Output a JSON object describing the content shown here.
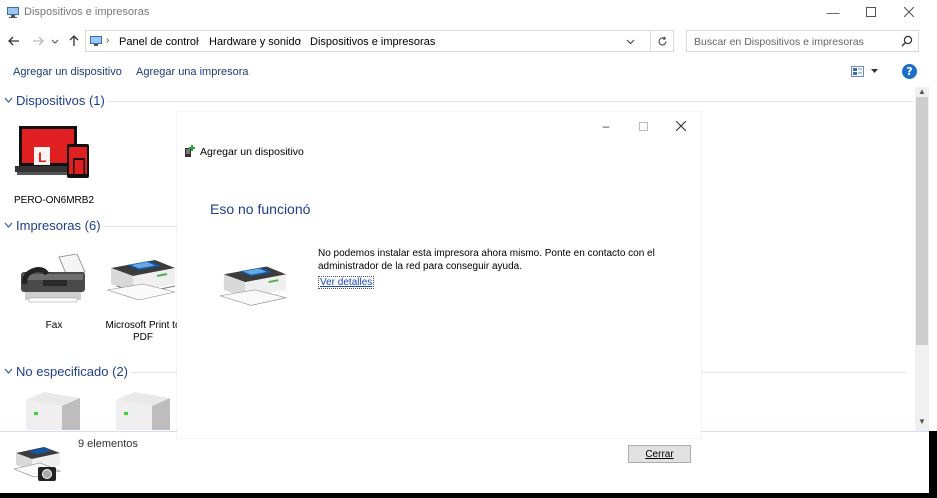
{
  "window": {
    "title": "Dispositivos e impresoras"
  },
  "address": {
    "crumbs": [
      "Panel de control",
      "Hardware y sonido",
      "Dispositivos e impresoras"
    ],
    "search_placeholder": "Buscar en Dispositivos e impresoras"
  },
  "commands": {
    "add_device": "Agregar un dispositivo",
    "add_printer": "Agregar una impresora"
  },
  "groups": {
    "devices": {
      "header": "Dispositivos (1)",
      "items": [
        "PERO-ON6MRB2"
      ]
    },
    "printers": {
      "header": "Impresoras (6)",
      "items": [
        "Fax",
        "Microsoft Print to PDF"
      ]
    },
    "unspecified": {
      "header": "No especificado (2)"
    }
  },
  "details": {
    "count": "9 elementos"
  },
  "dialog": {
    "header": "Agregar un dispositivo",
    "title": "Eso no funcionó",
    "message": "No podemos instalar esta impresora ahora mismo. Ponte en contacto con el administrador de la red para conseguir ayuda.",
    "link": "Ver detalles",
    "close_button": "Cerrar"
  },
  "colors": {
    "accent_heading": "#1e3f8a",
    "link": "#1a47b8",
    "help": "#1e6fc9",
    "device_red": "#e02020"
  },
  "icons": {
    "help": "?"
  }
}
